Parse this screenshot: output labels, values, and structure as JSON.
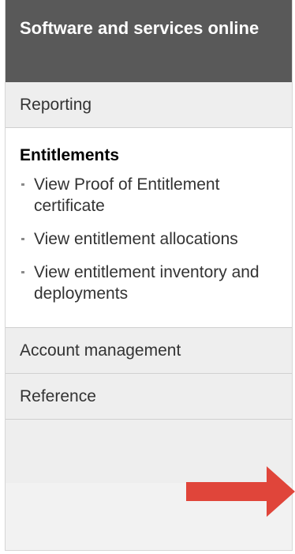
{
  "nav": {
    "header": "Software and services online",
    "reporting": "Reporting",
    "entitlements": {
      "title": "Entitlements",
      "items": [
        "View Proof of Entitlement certificate",
        "View entitlement allocations",
        "View entitlement inventory and deployments"
      ]
    },
    "account_management": "Account management",
    "reference": "Reference"
  },
  "colors": {
    "header_bg": "#595959",
    "arrow": "#e0453a"
  },
  "icons": {
    "arrow": "right-arrow-icon",
    "bullet": "bullet-icon"
  }
}
